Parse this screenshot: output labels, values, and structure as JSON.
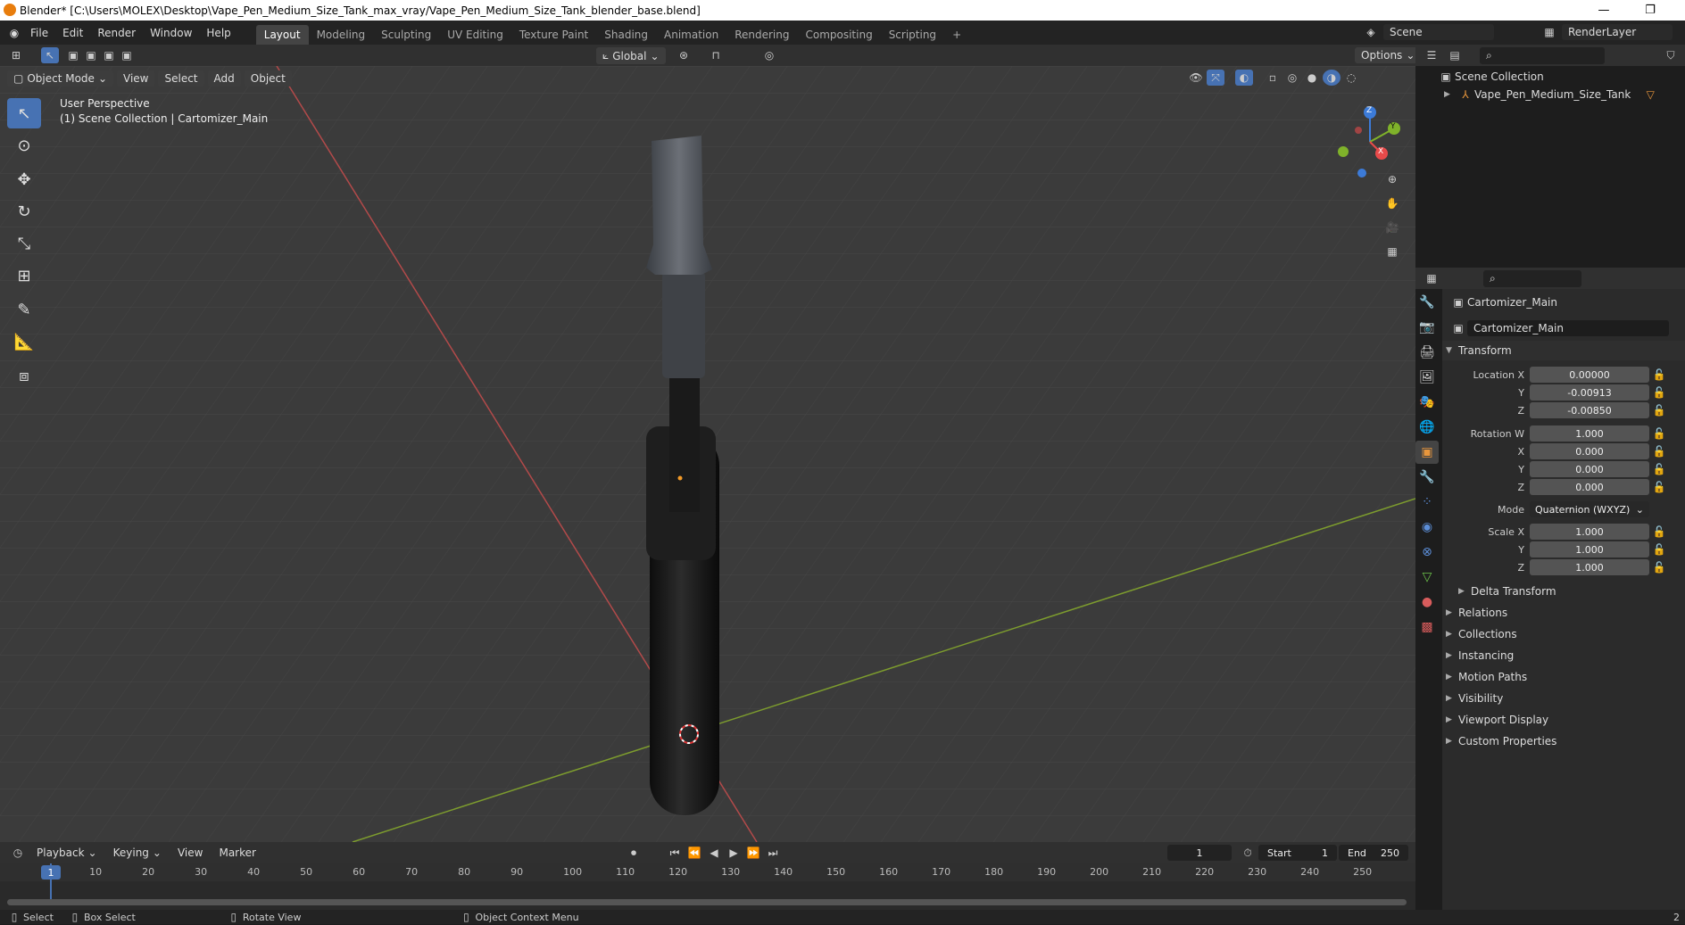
{
  "window": {
    "title": "Blender* [C:\\Users\\MOLEX\\Desktop\\Vape_Pen_Medium_Size_Tank_max_vray/Vape_Pen_Medium_Size_Tank_blender_base.blend]",
    "minimize": "—",
    "restore": "❐"
  },
  "menu": {
    "items": [
      "File",
      "Edit",
      "Render",
      "Window",
      "Help"
    ],
    "workspaces": [
      "Layout",
      "Modeling",
      "Sculpting",
      "UV Editing",
      "Texture Paint",
      "Shading",
      "Animation",
      "Rendering",
      "Compositing",
      "Scripting"
    ],
    "add_tab": "+",
    "scene": "Scene",
    "render_layer": "RenderLayer"
  },
  "viewport_header": {
    "mode": "Object Mode",
    "menus": [
      "View",
      "Select",
      "Add",
      "Object"
    ],
    "orientation": "Global",
    "options": "Options"
  },
  "viewport": {
    "perspective": "User Perspective",
    "collection_info": "(1) Scene Collection | Cartomizer_Main",
    "gizmo": {
      "z": "Z",
      "y": "Y",
      "x": "X"
    }
  },
  "outliner": {
    "root": "Scene Collection",
    "items": [
      "Vape_Pen_Medium_Size_Tank"
    ]
  },
  "properties": {
    "object_name": "Cartomizer_Main",
    "data_name": "Cartomizer_Main",
    "transform_title": "Transform",
    "location_label": "Location X",
    "location": {
      "x": "0.00000",
      "y": "-0.00913",
      "z": "-0.00850"
    },
    "rotation_label": "Rotation W",
    "rotation": {
      "w": "1.000",
      "x": "0.000",
      "y": "0.000",
      "z": "0.000"
    },
    "mode_label": "Mode",
    "mode_value": "Quaternion (WXYZ)",
    "scale_label": "Scale X",
    "scale": {
      "x": "1.000",
      "y": "1.000",
      "z": "1.000"
    },
    "axis_y": "Y",
    "axis_z": "Z",
    "axis_x": "X",
    "delta_transform": "Delta Transform",
    "panels": [
      "Relations",
      "Collections",
      "Instancing",
      "Motion Paths",
      "Visibility",
      "Viewport Display",
      "Custom Properties"
    ]
  },
  "timeline": {
    "menus": [
      "Playback",
      "Keying",
      "View",
      "Marker"
    ],
    "current_frame": "1",
    "start_label": "Start",
    "start": "1",
    "end_label": "End",
    "end": "250",
    "ruler": [
      "1",
      "10",
      "20",
      "30",
      "40",
      "50",
      "60",
      "70",
      "80",
      "90",
      "100",
      "110",
      "120",
      "130",
      "140",
      "150",
      "160",
      "170",
      "180",
      "190",
      "200",
      "210",
      "220",
      "230",
      "240",
      "250"
    ]
  },
  "status": {
    "select": "Select",
    "box_select": "Box Select",
    "rotate": "Rotate View",
    "context": "Object Context Menu",
    "version": "2"
  }
}
